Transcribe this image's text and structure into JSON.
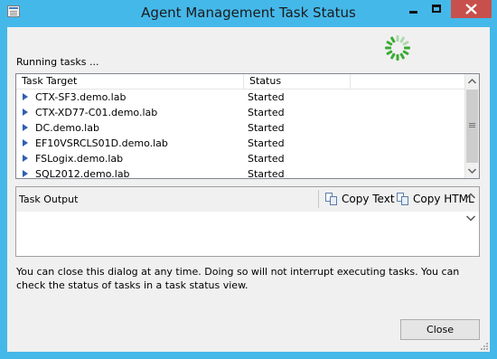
{
  "window": {
    "title": "Agent Management Task Status",
    "icon": "window-app-icon",
    "controls": [
      "minimize-icon",
      "maximize-icon",
      "close-icon"
    ]
  },
  "status": {
    "running_label": "Running tasks ...",
    "spinner_icon": "progress-spinner-icon"
  },
  "task_list": {
    "columns": [
      "Task Target",
      "Status"
    ],
    "rows": [
      {
        "target": "CTX-SF3.demo.lab",
        "status": "Started"
      },
      {
        "target": "CTX-XD77-C01.demo.lab",
        "status": "Started"
      },
      {
        "target": "DC.demo.lab",
        "status": "Started"
      },
      {
        "target": "EF10VSRCLS01D.demo.lab",
        "status": "Started"
      },
      {
        "target": "FSLogix.demo.lab",
        "status": "Started"
      },
      {
        "target": "SQL2012.demo.lab",
        "status": "Started"
      }
    ],
    "row_icon": "expand-arrow-icon"
  },
  "output": {
    "label": "Task Output",
    "copy_text_label": "Copy Text",
    "copy_html_label": "Copy HTML",
    "content": ""
  },
  "notice": "You can close this dialog at any time. Doing so will not interrupt executing tasks. You can check the status of tasks in a task status view.",
  "buttons": {
    "close": "Close"
  },
  "colors": {
    "frame": "#45b8ea",
    "close_button": "#c7504c",
    "spinner": "#3aaa35",
    "expander": "#2f5fb0",
    "dialog_background": "#f0f0f0"
  }
}
